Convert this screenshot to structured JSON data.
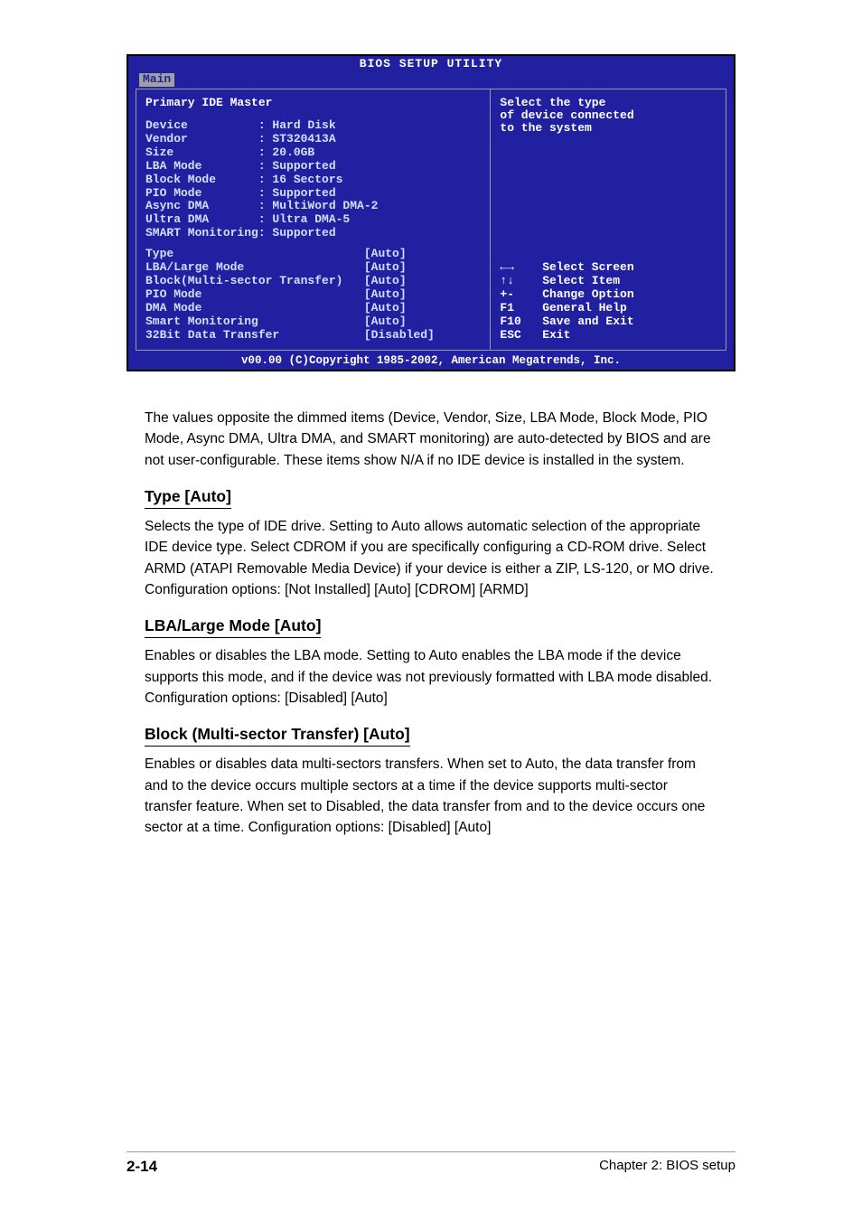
{
  "bios": {
    "title": "BIOS SETUP UTILITY",
    "tab": "Main",
    "section_title": "Primary IDE Master",
    "info_rows": [
      {
        "label": "Device",
        "value": "Hard Disk"
      },
      {
        "label": "Vendor",
        "value": "ST320413A"
      },
      {
        "label": "Size",
        "value": "20.0GB"
      },
      {
        "label": "LBA Mode",
        "value": "Supported"
      },
      {
        "label": "Block Mode",
        "value": "16 Sectors"
      },
      {
        "label": "PIO Mode",
        "value": "Supported"
      },
      {
        "label": "Async DMA",
        "value": "MultiWord DMA-2"
      },
      {
        "label": "Ultra DMA",
        "value": "Ultra DMA-5"
      },
      {
        "label": "SMART Monitoring",
        "value": "Supported"
      }
    ],
    "options": [
      {
        "label": "Type",
        "value": "[Auto]"
      },
      {
        "label": "LBA/Large Mode",
        "value": "[Auto]"
      },
      {
        "label": "Block(Multi-sector Transfer)",
        "value": "[Auto]"
      },
      {
        "label": "PIO Mode",
        "value": "[Auto]"
      },
      {
        "label": "DMA Mode",
        "value": "[Auto]"
      },
      {
        "label": "Smart Monitoring",
        "value": "[Auto]"
      },
      {
        "label": "32Bit Data Transfer",
        "value": "[Disabled]"
      }
    ],
    "help_text": "Select the type\nof device connected\nto the system",
    "keyhints": [
      {
        "key": "←→",
        "desc": "Select Screen"
      },
      {
        "key": "↑↓",
        "desc": "Select Item"
      },
      {
        "key": "+-",
        "desc": "Change Option"
      },
      {
        "key": "F1",
        "desc": "General Help"
      },
      {
        "key": "F10",
        "desc": "Save and Exit"
      },
      {
        "key": "ESC",
        "desc": "Exit"
      }
    ],
    "footer": "v00.00 (C)Copyright 1985-2002, American Megatrends, Inc."
  },
  "doc": {
    "intro": "The values opposite the dimmed items (Device, Vendor, Size, LBA Mode, Block Mode, PIO Mode, Async DMA, Ultra DMA, and SMART monitoring) are auto-detected by BIOS and are not user-configurable. These items show N/A if no IDE device is installed in the system.",
    "sections": [
      {
        "heading": "Type [Auto]",
        "paras": [
          "Selects the type of IDE drive. Setting to Auto allows automatic selection of the appropriate IDE device type. Select CDROM if you are specifically configuring a CD-ROM drive. Select ARMD (ATAPI Removable Media Device) if your device is either a ZIP, LS-120, or MO drive. Configuration options: [Not Installed] [Auto] [CDROM] [ARMD]"
        ]
      },
      {
        "heading": "LBA/Large Mode [Auto]",
        "paras": [
          "Enables or disables the LBA mode. Setting to Auto enables the LBA mode if the device supports this mode, and if the device was not previously formatted with LBA mode disabled. Configuration options: [Disabled] [Auto]"
        ]
      },
      {
        "heading": "Block (Multi-sector Transfer) [Auto]",
        "paras": [
          "Enables or disables data multi-sectors transfers. When set to Auto, the data transfer from and to the device occurs multiple sectors at a time if the device supports multi-sector transfer feature. When set to Disabled, the data transfer from and to the device occurs one sector at a time. Configuration options: [Disabled] [Auto]"
        ]
      }
    ]
  },
  "footer": {
    "left": "2-14",
    "right": "Chapter 2: BIOS setup"
  }
}
